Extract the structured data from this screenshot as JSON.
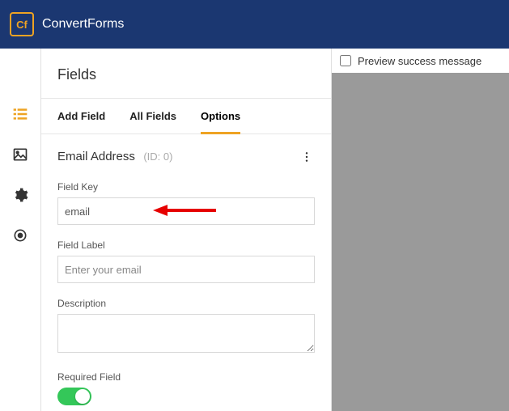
{
  "brand": "ConvertForms",
  "logo_text": "Cf",
  "panel": {
    "title": "Fields"
  },
  "tabs": [
    {
      "label": "Add Field",
      "active": false
    },
    {
      "label": "All Fields",
      "active": false
    },
    {
      "label": "Options",
      "active": true
    }
  ],
  "section": {
    "title": "Email Address",
    "id_text": "(ID: 0)"
  },
  "form": {
    "field_key": {
      "label": "Field Key",
      "value": "email"
    },
    "field_label": {
      "label": "Field Label",
      "placeholder": "Enter your email",
      "value": ""
    },
    "description": {
      "label": "Description",
      "value": ""
    },
    "required": {
      "label": "Required Field",
      "on": true
    }
  },
  "preview": {
    "checkbox_label": "Preview success message",
    "checked": false
  }
}
